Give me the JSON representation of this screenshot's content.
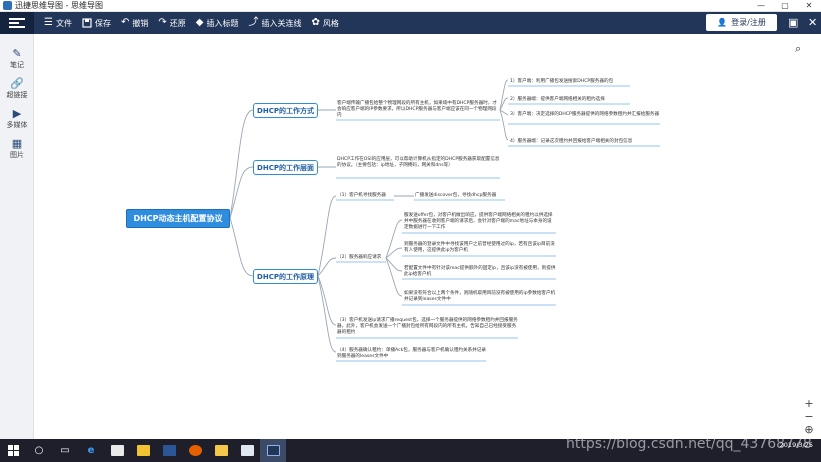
{
  "window": {
    "title": "迅捷思维导图 - 思维导图",
    "controls": [
      "—",
      "▢",
      "✕"
    ]
  },
  "toolbar": {
    "items": [
      {
        "label": "文件",
        "icon": "menu-icon"
      },
      {
        "label": "保存",
        "icon": "save-icon"
      },
      {
        "label": "撤销",
        "icon": "undo-icon"
      },
      {
        "label": "还原",
        "icon": "redo-icon"
      },
      {
        "label": "插入标题",
        "icon": "insert-title-icon"
      },
      {
        "label": "插入关连线",
        "icon": "insert-link-line-icon"
      },
      {
        "label": "风格",
        "icon": "style-icon"
      }
    ],
    "login_label": "登录/注册"
  },
  "sidebar": {
    "items": [
      {
        "label": "笔记",
        "icon": "pen-icon"
      },
      {
        "label": "超链接",
        "icon": "hyperlink-icon"
      },
      {
        "label": "多媒体",
        "icon": "media-icon"
      },
      {
        "label": "图片",
        "icon": "image-icon"
      }
    ]
  },
  "mindmap": {
    "root": "DHCP动态主机配置协议",
    "branches": [
      {
        "label": "DHCP的工作方式",
        "desc": "客户端传输广播包给整个物理网段的所有主机，如果域中有DHCP服务器时，才会响应客户端的IP参数要求，所以DHCP服务器与客户端应该在同一个物理网段内",
        "items": [
          "1）客户端：利用广播包发送搜索DHCP服务器的包",
          "2）服务器端：提供客户端网络相关的租约选择",
          "3）客户端：决定选择的DHCP服务器提供的网络参数租约并汇报给服务器",
          "4）服务器端：记录这次租约并回报给客户端相关的封包信息"
        ]
      },
      {
        "label": "DHCP的工作层面",
        "desc": "DHCP工作在OSI的应用层，可以帮助计算机从指定的DHCP服务器获取配置信息的协议。（主要包括：ip地址，子网掩码，网关和dns等）"
      },
      {
        "label": "DHCP的工作原理",
        "steps": [
          {
            "label": "（1）客户机寻找服务器",
            "detail": "广播发送discover包，寻找dhcp服务器"
          },
          {
            "label": "（2）服务器响应请求",
            "details": [
              "服发送offer包，对客户机做出响应，提供客户端网络相关的租约以供选择并中服务器在收到客户端的请求后，会针对客户端的mac地址与本身的设定数据进行一下工作",
              "到服务器的登录文件中寻找该用户之前曾经使用过的ip，若有且该ip目前没有人使用，这提供此ip为客户机",
              "若配置文件中有针对该mac提供额外的固定ip，且该ip没有被使用，则提供此ip给客户机",
              "如果没有符合以上两个条件，则随机取用目前没有被使用的ip参数给客户机并记录到leases文件中"
            ]
          },
          {
            "label": "（3）客户机发送ip请求广播request包，选择一个服务器提供的网络参数租约并回报服务器，此外，客户机会发送一个广播封包给所有网段内的所有主机，告知自己已经接受服务器的租约",
            "detail": ""
          },
          {
            "label": "（4）服务器确认租约：单播Ack包，服务器与客户机确认租约关系并记录到服务器的leases文件中",
            "detail": ""
          }
        ]
      }
    ]
  },
  "zoom_controls": [
    "+",
    "−",
    "⊕"
  ],
  "taskbar": {
    "watermark": "https://blog.csdn.net/qq_43768778",
    "date": "2019/3/25"
  },
  "colors": {
    "toolbar": "#22365a",
    "accent": "#2f8ddd",
    "taskbar": "#1f1f2b"
  }
}
